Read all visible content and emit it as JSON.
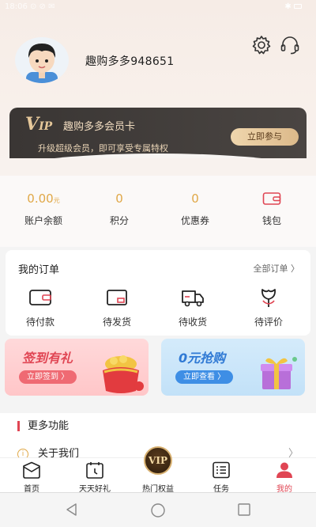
{
  "statusbar": {
    "left": "18:06 ⊙ ⊘ ✉",
    "right": "✱"
  },
  "profile": {
    "username": "趣购多多948651"
  },
  "vip_card": {
    "logo_big": "V",
    "logo_small": "IP",
    "title": "趣购多多会员卡",
    "subtitle": "升级超级会员，即可享受专属特权",
    "button": "立即参与"
  },
  "assets": [
    {
      "value": "0.00",
      "unit": "元",
      "label": "账户余额"
    },
    {
      "value": "0",
      "label": "积分"
    },
    {
      "value": "0",
      "label": "优惠券"
    },
    {
      "label": "钱包"
    }
  ],
  "orders": {
    "title": "我的订单",
    "all": "全部订单 〉",
    "items": [
      {
        "label": "待付款",
        "icon": "wallet-icon"
      },
      {
        "label": "待发货",
        "icon": "box-icon"
      },
      {
        "label": "待收货",
        "icon": "truck-icon"
      },
      {
        "label": "待评价",
        "icon": "flower-icon"
      }
    ]
  },
  "banners": {
    "left": {
      "title": "签到有礼",
      "button": "立即签到 〉"
    },
    "right": {
      "title": "0元抢购",
      "button": "立即查看 〉"
    }
  },
  "more": {
    "title": "更多功能",
    "row_icon": "i",
    "row_label": "关于我们",
    "row_arrow": "〉"
  },
  "tabbar": {
    "vip_badge": "VIP",
    "items": [
      {
        "label": "首页"
      },
      {
        "label": "天天好礼"
      },
      {
        "label": "热门权益"
      },
      {
        "label": "任务"
      },
      {
        "label": "我的"
      }
    ]
  },
  "colors": {
    "accent": "#e04553",
    "gold": "#e0a847",
    "vip_dark": "#3a3634"
  }
}
